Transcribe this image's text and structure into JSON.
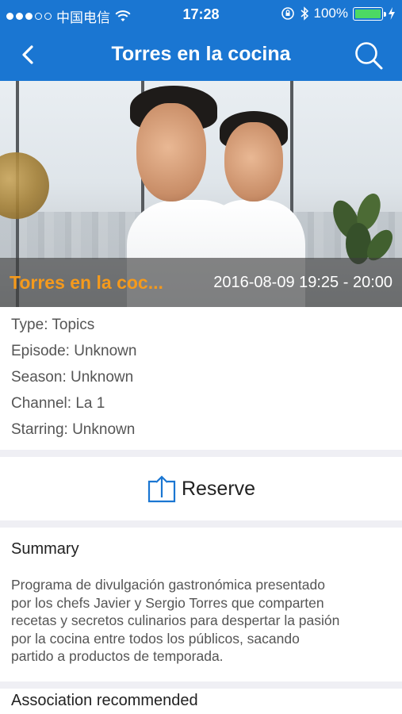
{
  "status_bar": {
    "carrier": "中国电信",
    "time": "17:28",
    "battery": "100%",
    "signal_bars_filled": 3,
    "signal_bars_total": 5
  },
  "nav": {
    "title": "Torres en la cocina",
    "back_icon": "chevron-left-icon",
    "search_icon": "search-icon"
  },
  "hero": {
    "show_title": "Torres en la coc...",
    "airtime": "2016-08-09 19:25 - 20:00"
  },
  "info": {
    "type": "Type: Topics",
    "episode": "Episode: Unknown",
    "season": "Season: Unknown",
    "channel": "Channel: La 1",
    "starring": "Starring: Unknown"
  },
  "reserve": {
    "label": "Reserve",
    "icon": "upload-arrow-icon"
  },
  "summary": {
    "heading": "Summary",
    "lines": [
      "Programa de divulgación gastronómica presentado",
      "por los chefs Javier y Sergio Torres que comparten",
      "recetas y secretos culinarios para despertar la pasión",
      "por la cocina entre todos los públicos, sacando",
      "partido a productos de temporada."
    ]
  },
  "association": {
    "heading": "Association recommended"
  },
  "colors": {
    "brand_blue": "#1a76d2",
    "accent_orange": "#f59a1c",
    "battery_green": "#4cd964",
    "section_gray": "#efeff4"
  }
}
